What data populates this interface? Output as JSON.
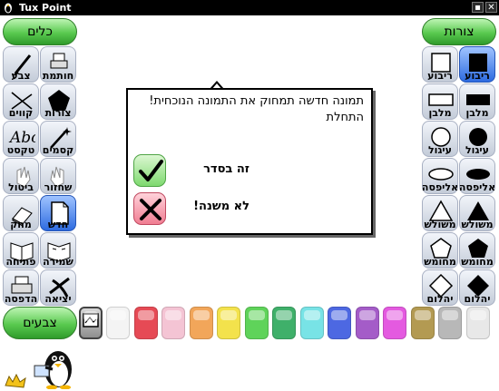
{
  "window": {
    "title": "Tux Point",
    "minimize": "▪",
    "close": "✕"
  },
  "tools_header": "כלים",
  "shapes_header": "צורות",
  "colors_button": "צבעים",
  "tools": [
    {
      "label": "צבע",
      "icon": "paintbrush-icon",
      "selected": false
    },
    {
      "label": "חותמת",
      "icon": "stamp-icon",
      "selected": false
    },
    {
      "label": "קווים",
      "icon": "lines-icon",
      "selected": false
    },
    {
      "label": "צורות",
      "icon": "pentagon-icon",
      "selected": false
    },
    {
      "label": "טקסט",
      "icon": "text-abc-icon",
      "selected": false
    },
    {
      "label": "קסמים",
      "icon": "magic-wand-icon",
      "selected": false
    },
    {
      "label": "ביטול",
      "icon": "undo-hand-icon",
      "selected": false
    },
    {
      "label": "שחזור",
      "icon": "redo-hand-icon",
      "selected": false
    },
    {
      "label": "מחק",
      "icon": "eraser-icon",
      "selected": false
    },
    {
      "label": "חדש",
      "icon": "new-page-icon",
      "selected": true
    },
    {
      "label": "פתיחה",
      "icon": "open-book-icon",
      "selected": false
    },
    {
      "label": "שמירה",
      "icon": "save-book-icon",
      "selected": false
    },
    {
      "label": "הדפסה",
      "icon": "printer-icon",
      "selected": false
    },
    {
      "label": "יציאה",
      "icon": "exit-x-icon",
      "selected": false
    }
  ],
  "shapes": [
    {
      "label": "ריבוע",
      "icon": "square-outline-icon",
      "selected": false
    },
    {
      "label": "ריבוע",
      "icon": "square-filled-icon",
      "selected": true
    },
    {
      "label": "מלבן",
      "icon": "rectangle-outline-icon",
      "selected": false
    },
    {
      "label": "מלבן",
      "icon": "rectangle-filled-icon",
      "selected": false
    },
    {
      "label": "עיגול",
      "icon": "circle-outline-icon",
      "selected": false
    },
    {
      "label": "עיגול",
      "icon": "circle-filled-icon",
      "selected": false
    },
    {
      "label": "אליפסה",
      "icon": "ellipse-outline-icon",
      "selected": false
    },
    {
      "label": "אליפסה",
      "icon": "ellipse-filled-icon",
      "selected": false
    },
    {
      "label": "משולש",
      "icon": "triangle-outline-icon",
      "selected": false
    },
    {
      "label": "משולש",
      "icon": "triangle-filled-icon",
      "selected": false
    },
    {
      "label": "מחומש",
      "icon": "pentagon-outline-icon",
      "selected": false
    },
    {
      "label": "מחומש",
      "icon": "pentagon-filled-icon",
      "selected": false
    },
    {
      "label": "יהלום",
      "icon": "diamond-outline-icon",
      "selected": false
    },
    {
      "label": "יהלום",
      "icon": "diamond-filled-icon",
      "selected": false
    }
  ],
  "dialog": {
    "message": "תמונה חדשה תמחוק את התמונה הנוכחית! התחלת",
    "ok_label": "זה בסדר",
    "cancel_label": "לא משנה!"
  },
  "palette": {
    "picker_icon": "color-picker-icon",
    "colors": [
      "#f4f4f4",
      "#e64a55",
      "#f4c4d4",
      "#f2a65a",
      "#f3e24c",
      "#5fd35a",
      "#3fb06a",
      "#78e3e6",
      "#4d68e2",
      "#a45cc8",
      "#e45ae0",
      "#b39a52",
      "#b8b8b8",
      "#e8e8e8"
    ]
  }
}
